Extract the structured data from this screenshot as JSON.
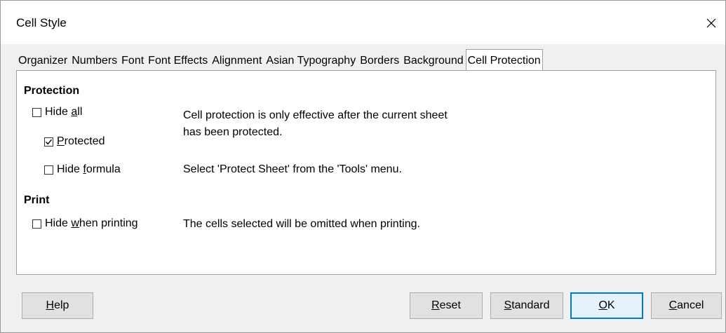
{
  "window": {
    "title": "Cell Style"
  },
  "tabs": [
    {
      "label": "Organizer"
    },
    {
      "label": "Numbers"
    },
    {
      "label": "Font"
    },
    {
      "label": "Font Effects"
    },
    {
      "label": "Alignment"
    },
    {
      "label": "Asian Typography"
    },
    {
      "label": "Borders"
    },
    {
      "label": "Background"
    },
    {
      "label": "Cell Protection"
    }
  ],
  "active_tab": "Cell Protection",
  "protection": {
    "heading": "Protection",
    "hide_all": {
      "before": "Hide ",
      "mnemonic": "a",
      "after": "ll",
      "checked": false
    },
    "protected": {
      "before": "",
      "mnemonic": "P",
      "after": "rotected",
      "checked": true
    },
    "hide_formula": {
      "before": "Hide ",
      "mnemonic": "f",
      "after": "ormula",
      "checked": false
    },
    "note_line1": "Cell protection is only effective after the current sheet",
    "note_line2": "has been protected.",
    "note_tools": "Select 'Protect Sheet' from the 'Tools' menu."
  },
  "print": {
    "heading": "Print",
    "hide_when_printing": {
      "before": "Hide ",
      "mnemonic": "w",
      "after": "hen printing",
      "checked": false
    },
    "note": "The cells selected will be omitted when printing."
  },
  "buttons": {
    "help": {
      "before": "",
      "mnemonic": "H",
      "after": "elp"
    },
    "reset": {
      "before": "",
      "mnemonic": "R",
      "after": "eset"
    },
    "standard": {
      "before": "",
      "mnemonic": "S",
      "after": "tandard"
    },
    "ok": {
      "before": "",
      "mnemonic": "O",
      "after": "K"
    },
    "cancel": {
      "before": "",
      "mnemonic": "C",
      "after": "ancel"
    }
  }
}
